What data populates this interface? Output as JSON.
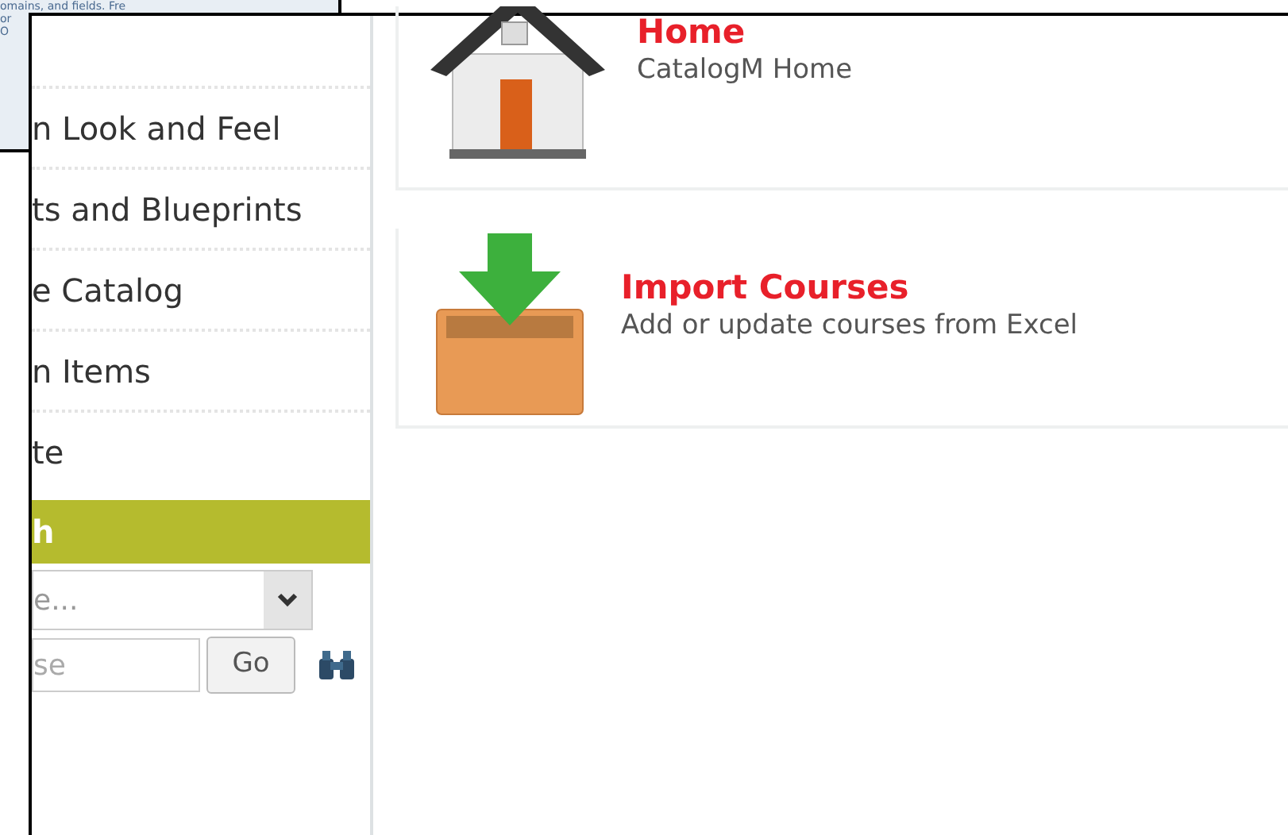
{
  "background_window": {
    "lines": [
      "omains, and fields. Fre",
      "or",
      "O"
    ]
  },
  "sidebar": {
    "items": [
      {
        "label": "n Look and Feel"
      },
      {
        "label": "ts and Blueprints"
      },
      {
        "label": "e Catalog"
      },
      {
        "label": "n Items"
      },
      {
        "label": "te"
      }
    ],
    "search": {
      "title": "h",
      "select": {
        "placeholder": "e..."
      },
      "input": {
        "placeholder": "se"
      },
      "button": "Go"
    }
  },
  "cards": [
    {
      "kind": "home",
      "title": "Home",
      "description": "CatalogM Home"
    },
    {
      "kind": "import",
      "title": "Import Courses",
      "description": "Add or update courses from Excel"
    }
  ]
}
